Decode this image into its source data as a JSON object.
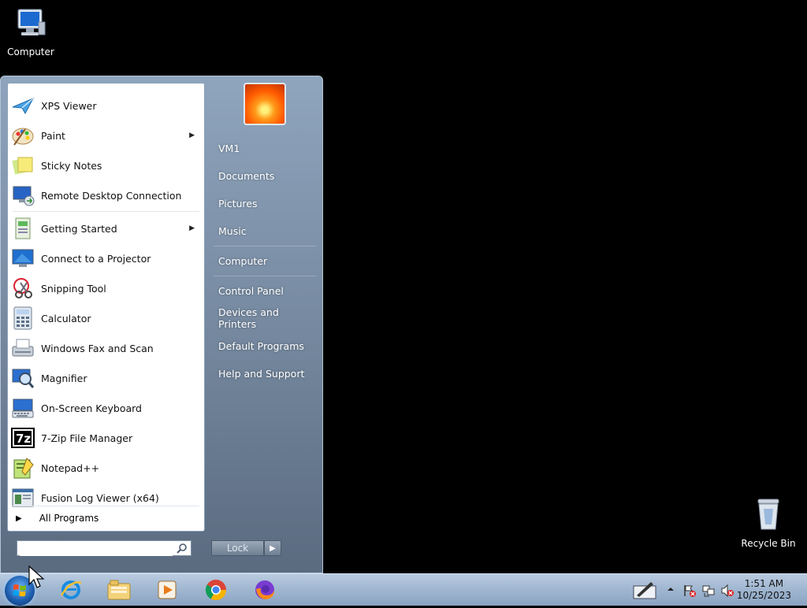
{
  "desktop": {
    "icons": [
      {
        "label": "Computer",
        "icon": "computer-icon"
      },
      {
        "label": "Recycle Bin",
        "icon": "recycle-bin-icon"
      }
    ]
  },
  "start_menu": {
    "programs": [
      {
        "label": "XPS Viewer",
        "icon": "xps-viewer-icon",
        "has_submenu": false
      },
      {
        "label": "Paint",
        "icon": "paint-icon",
        "has_submenu": true
      },
      {
        "label": "Sticky Notes",
        "icon": "sticky-notes-icon",
        "has_submenu": false
      },
      {
        "label": "Remote Desktop Connection",
        "icon": "remote-desktop-icon",
        "has_submenu": false
      },
      {
        "label": "Getting Started",
        "icon": "getting-started-icon",
        "has_submenu": true
      },
      {
        "label": "Connect to a Projector",
        "icon": "projector-icon",
        "has_submenu": false
      },
      {
        "label": "Snipping Tool",
        "icon": "snipping-tool-icon",
        "has_submenu": false
      },
      {
        "label": "Calculator",
        "icon": "calculator-icon",
        "has_submenu": false
      },
      {
        "label": "Windows Fax and Scan",
        "icon": "fax-scan-icon",
        "has_submenu": false
      },
      {
        "label": "Magnifier",
        "icon": "magnifier-icon",
        "has_submenu": false
      },
      {
        "label": "On-Screen Keyboard",
        "icon": "keyboard-icon",
        "has_submenu": false
      },
      {
        "label": "7-Zip File Manager",
        "icon": "seven-zip-icon",
        "has_submenu": false
      },
      {
        "label": "Notepad++",
        "icon": "notepadpp-icon",
        "has_submenu": false
      },
      {
        "label": "Fusion Log Viewer (x64)",
        "icon": "fusion-log-icon",
        "has_submenu": false
      }
    ],
    "all_programs": "All Programs",
    "search_placeholder": "",
    "right_links": {
      "user": "VM1",
      "documents": "Documents",
      "pictures": "Pictures",
      "music": "Music",
      "computer": "Computer",
      "control_panel": "Control Panel",
      "devices": "Devices and Printers",
      "default_programs": "Default Programs",
      "help": "Help and Support"
    },
    "lock_label": "Lock"
  },
  "taskbar": {
    "pinned": [
      "internet-explorer-icon",
      "file-explorer-icon",
      "media-player-icon",
      "chrome-icon",
      "firefox-icon"
    ],
    "clock_time": "1:51 AM",
    "clock_date": "10/25/2023"
  }
}
